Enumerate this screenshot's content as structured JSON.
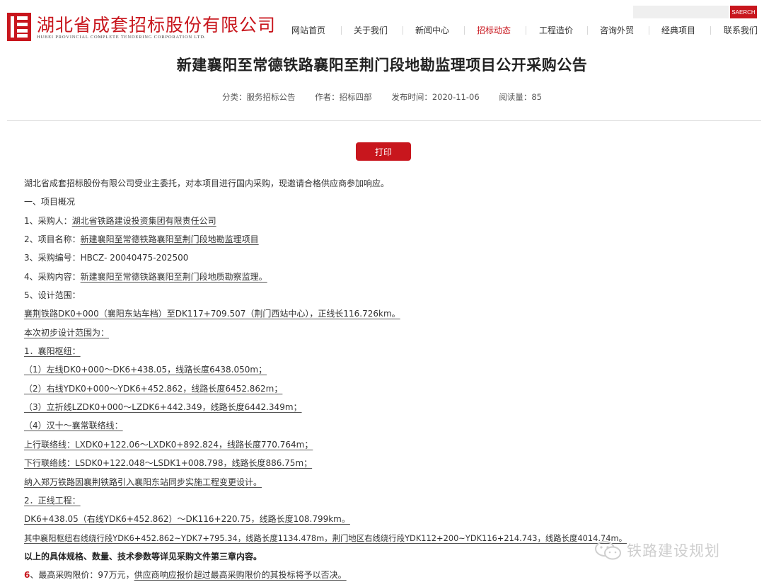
{
  "header": {
    "logo_cn": "湖北省成套招标股份有限公司",
    "logo_en": "HUBEI PROVINCIAL COMPLETE TENDERING CORPORATION LTD.",
    "search_placeholder": "",
    "search_button": "SAERCH",
    "nav": [
      "网站首页",
      "关于我们",
      "新闻中心",
      "招标动态",
      "工程造价",
      "咨询外贸",
      "经典项目",
      "联系我们"
    ],
    "active_nav": "招标动态"
  },
  "article": {
    "title": "新建襄阳至常德铁路襄阳至荆门段地勘监理项目公开采购公告",
    "meta": {
      "category": "分类：服务招标公告",
      "author": "作者：招标四部",
      "published": "发布时间：2020-11-06",
      "views": "阅读量：85"
    },
    "print_label": "打印",
    "lines": [
      "湖北省成套招标股份有限公司受业主委托，对本项目进行国内采购，现邀请合格供应商参加响应。",
      "一、项目概况",
      "1、采购人：",
      "湖北省铁路建设投资集团有限责任公司",
      "2、项目名称：",
      "新建襄阳至常德铁路襄阳至荆门段地勘监理项目",
      "3、采购编号：HBCZ- 20040475-202500",
      "4、采购内容：",
      "新建襄阳至常德铁路襄阳至荆门段地质勘察监理。",
      "5、设计范围：",
      "襄荆铁路DK0+000（襄阳东站车档）至DK117+709.507（荆门西站中心），正线长116.726km。",
      "本次初步设计范围为：",
      "1．襄阳枢纽：",
      "（1）左线DK0+000～DK6+438.05，线路长度6438.050m；",
      "（2）右线YDK0+000～YDK6+452.862，线路长度6452.862m；",
      "（3）立折线LZDK0+000～LZDK6+442.349，线路长度6442.349m；",
      "（4）汉十～襄常联络线：",
      "上行联络线：LXDK0+122.06～LXDK0+892.824，线路长度770.764m；",
      "下行联络线：LSDK0+122.048～LSDK1+008.798，线路长度886.75m；",
      "纳入郑万铁路因襄荆铁路引入襄阳东站同步实施工程变更设计。",
      "2．正线工程：",
      "DK6+438.05（右线YDK6+452.862）～DK116+220.75，线路长度108.799km。",
      "其中襄阳枢纽右线绕行段YDK6+452.862~YDK7+795.34，线路长度1134.478m，荆门地区右线绕行段YDK112+200~YDK116+214.743，线路长度4014.74m。",
      "以上的具体规格、数量、技术参数等详见采购文件第三章内容。",
      "6",
      "、最高采购限价：97万元，",
      "供应商响应报价超过最高采购限价的其投标将予以否决。"
    ]
  },
  "watermark": {
    "text": "铁路建设规划",
    "icon": "wechat-icon"
  },
  "colors": {
    "brand_red": "#c8161d",
    "text": "#333333",
    "watermark": "#cfcfcf"
  }
}
